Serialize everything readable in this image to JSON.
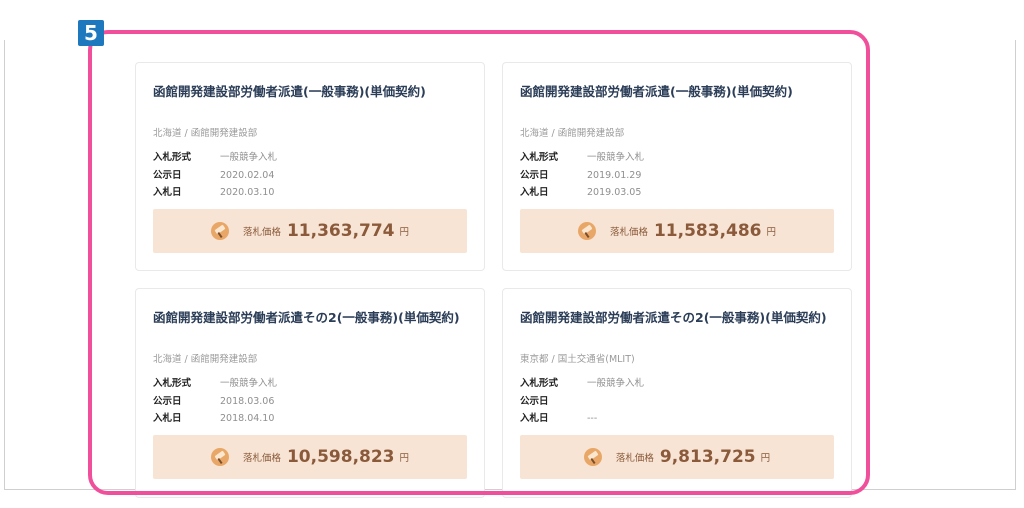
{
  "step_badge": "5",
  "price_label": "落札価格",
  "currency": "円",
  "colors": {
    "highlight": "#f0509b",
    "badge": "#1e78bd",
    "price_box": "#f7e4d5",
    "price_text": "#8a5a3a",
    "title": "#2b3d57"
  },
  "cards": [
    {
      "title": "函館開発建設部労働者派遣(一般事務)(単価契約)",
      "org": "北海道 / 函館開発建設部",
      "bid_type_label": "入札形式",
      "bid_type": "一般競争入札",
      "announce_label": "公示日",
      "announce_date": "2020.02.04",
      "bid_label": "入札日",
      "bid_date": "2020.03.10",
      "price": "11,363,774",
      "icon": "gavel-icon"
    },
    {
      "title": "函館開発建設部労働者派遣(一般事務)(単価契約)",
      "org": "北海道 / 函館開発建設部",
      "bid_type_label": "入札形式",
      "bid_type": "一般競争入札",
      "announce_label": "公示日",
      "announce_date": "2019.01.29",
      "bid_label": "入札日",
      "bid_date": "2019.03.05",
      "price": "11,583,486",
      "icon": "gavel-icon"
    },
    {
      "title": "函館開発建設部労働者派遣その2(一般事務)(単価契約)",
      "org": "北海道 / 函館開発建設部",
      "bid_type_label": "入札形式",
      "bid_type": "一般競争入札",
      "announce_label": "公示日",
      "announce_date": "2018.03.06",
      "bid_label": "入札日",
      "bid_date": "2018.04.10",
      "price": "10,598,823",
      "icon": "gavel-icon"
    },
    {
      "title": "函館開発建設部労働者派遣その2(一般事務)(単価契約)",
      "org": "東京都 / 国土交通省(MLIT)",
      "bid_type_label": "入札形式",
      "bid_type": "一般競争入札",
      "announce_label": "公示日",
      "announce_date": "",
      "bid_label": "入札日",
      "bid_date": "---",
      "price": "9,813,725",
      "icon": "gavel-icon"
    }
  ]
}
